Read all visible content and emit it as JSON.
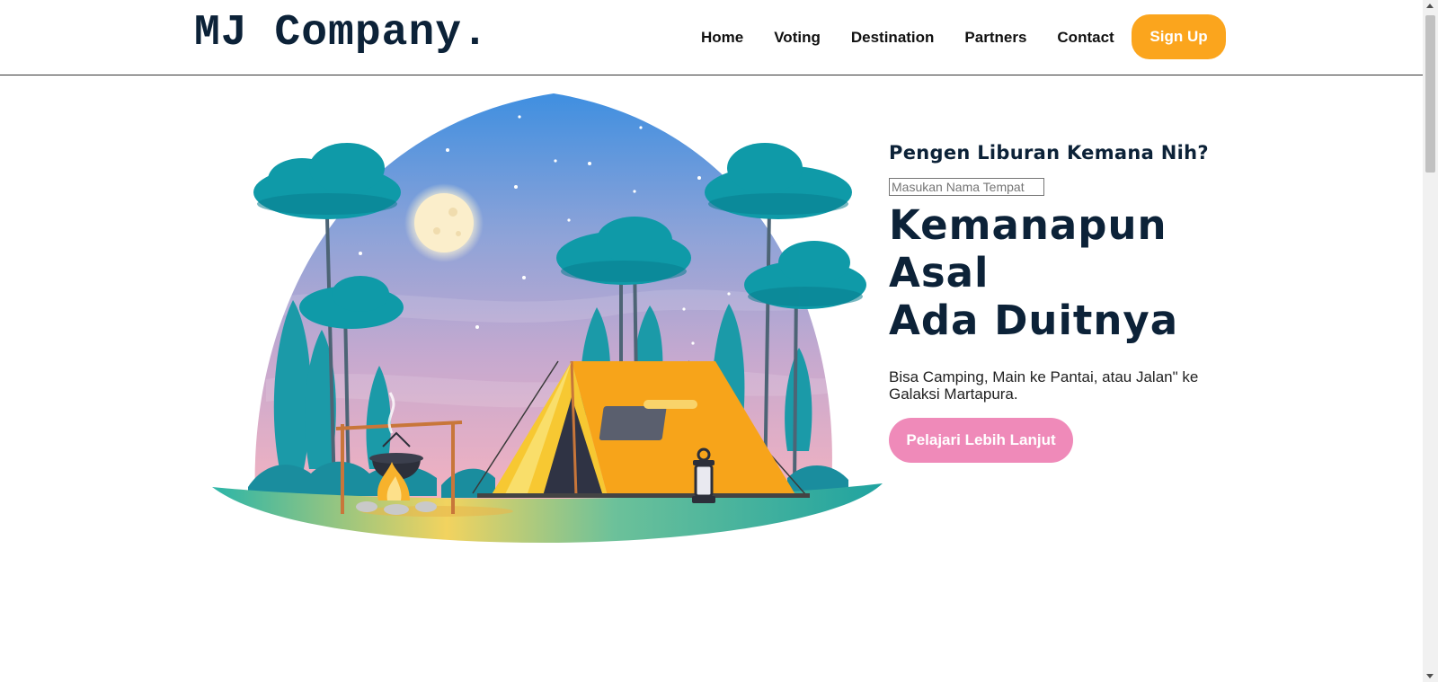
{
  "header": {
    "logo": "MJ Company.",
    "nav": [
      {
        "label": "Home"
      },
      {
        "label": "Voting"
      },
      {
        "label": "Destination"
      },
      {
        "label": "Partners"
      },
      {
        "label": "Contact"
      }
    ],
    "signup_label": "Sign Up"
  },
  "hero": {
    "subtitle": "Pengen Liburan Kemana Nih?",
    "search_placeholder": "Masukan Nama Tempat",
    "headline_line1": "Kemanapun Asal",
    "headline_line2": "Ada Duitnya",
    "description": "Bisa Camping, Main ke Pantai, atau Jalan\" ke Galaksi Martapura.",
    "cta_label": "Pelajari Lebih Lanjut",
    "illustration_icon": "camping-illustration-icon"
  },
  "colors": {
    "brand_dark": "#0c2238",
    "signup_bg": "#fba51d",
    "cta_bg": "#ef8ab9"
  }
}
